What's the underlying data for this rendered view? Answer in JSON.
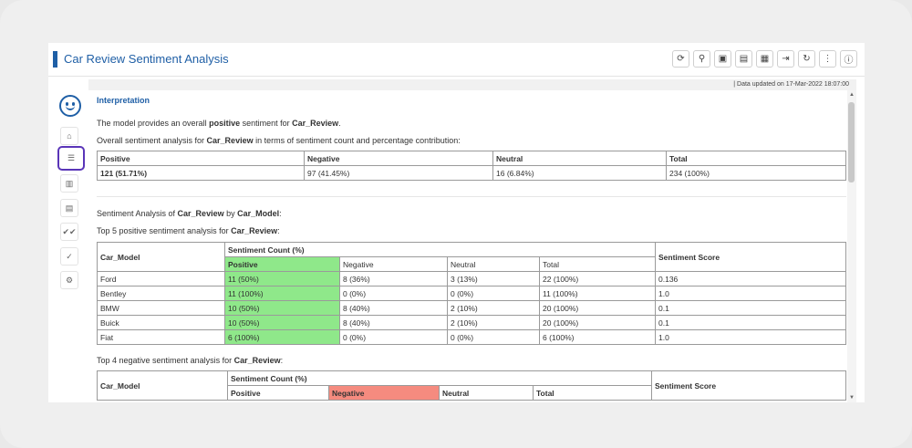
{
  "app": {
    "title": "Car Review Sentiment Analysis",
    "updated": "| Data updated on 17-Mar-2022 18:07:00"
  },
  "toolbar": [
    "⟳",
    "⚲",
    "▣",
    "▤",
    "▦",
    "⇥",
    "↻",
    "⋮",
    "ⓘ"
  ],
  "sidebar": [
    "⌂",
    "☰",
    "▥",
    "▤",
    "✔✔",
    "✓",
    "⚙"
  ],
  "interpretation": {
    "heading": "Interpretation",
    "line1_prefix": "The model provides an overall ",
    "line1_bold1": "positive",
    "line1_mid": " sentiment for ",
    "line1_bold2": "Car_Review",
    "line1_suffix": ".",
    "line2_prefix": "Overall sentiment analysis for ",
    "line2_bold": "Car_Review",
    "line2_suffix": " in terms of sentiment count and percentage contribution:"
  },
  "overall": {
    "headers": [
      "Positive",
      "Negative",
      "Neutral",
      "Total"
    ],
    "values": [
      "121 (51.71%)",
      "97 (41.45%)",
      "16 (6.84%)",
      "234 (100%)"
    ]
  },
  "by_model": {
    "line_prefix": "Sentiment Analysis of ",
    "line_bold1": "Car_Review",
    "line_mid": " by ",
    "line_bold2": "Car_Model",
    "line_suffix": ":",
    "pos_title_prefix": "Top 5 positive sentiment analysis for ",
    "pos_title_bold": "Car_Review",
    "pos_title_suffix": ":",
    "neg_title_prefix": "Top 4 negative sentiment analysis for ",
    "neg_title_bold": "Car_Review",
    "neg_title_suffix": ":"
  },
  "pos_table": {
    "col0": "Car_Model",
    "group": "Sentiment Count (%)",
    "subs": [
      "Positive",
      "Negative",
      "Neutral",
      "Total"
    ],
    "score": "Sentiment Score",
    "rows": [
      [
        "Ford",
        "11 (50%)",
        "8 (36%)",
        "3 (13%)",
        "22 (100%)",
        "0.136"
      ],
      [
        "Bentley",
        "11 (100%)",
        "0 (0%)",
        "0 (0%)",
        "11 (100%)",
        "1.0"
      ],
      [
        "BMW",
        "10 (50%)",
        "8 (40%)",
        "2 (10%)",
        "20 (100%)",
        "0.1"
      ],
      [
        "Buick",
        "10 (50%)",
        "8 (40%)",
        "2 (10%)",
        "20 (100%)",
        "0.1"
      ],
      [
        "Fiat",
        "6 (100%)",
        "0 (0%)",
        "0 (0%)",
        "6 (100%)",
        "1.0"
      ]
    ]
  },
  "neg_table": {
    "col0": "Car_Model",
    "group": "Sentiment Count (%)",
    "subs": [
      "Positive",
      "Negative",
      "Neutral",
      "Total"
    ],
    "score": "Sentiment Score"
  }
}
